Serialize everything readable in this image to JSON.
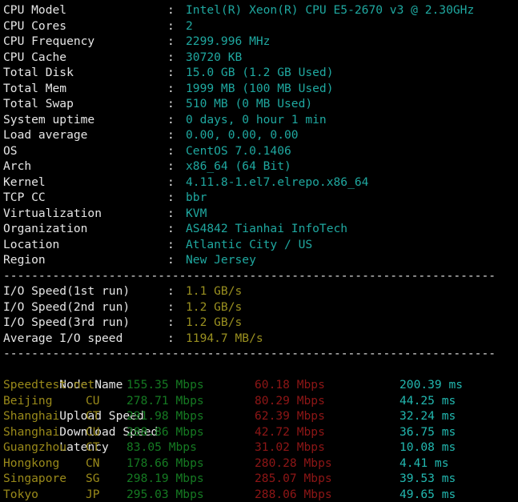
{
  "terminal": {
    "background_color": "#000000",
    "label_color": "#e6e6e6",
    "value_cyan": "#1fa8a0",
    "value_olive": "#9a9020",
    "node_color": "#9a8a1a",
    "upload_color": "#157a22",
    "download_color": "#8e1616",
    "latency_color": "#22b8b0",
    "separator": "----------------------------------------------------------------------"
  },
  "system_info": [
    {
      "label": "CPU Model",
      "value": "Intel(R) Xeon(R) CPU E5-2670 v3 @ 2.30GHz"
    },
    {
      "label": "CPU Cores",
      "value": "2"
    },
    {
      "label": "CPU Frequency",
      "value": "2299.996 MHz"
    },
    {
      "label": "CPU Cache",
      "value": "30720 KB"
    },
    {
      "label": "Total Disk",
      "value": "15.0 GB (1.2 GB Used)"
    },
    {
      "label": "Total Mem",
      "value": "1999 MB (100 MB Used)"
    },
    {
      "label": "Total Swap",
      "value": "510 MB (0 MB Used)"
    },
    {
      "label": "System uptime",
      "value": "0 days, 0 hour 1 min"
    },
    {
      "label": "Load average",
      "value": "0.00, 0.00, 0.00"
    },
    {
      "label": "OS",
      "value": "CentOS 7.0.1406"
    },
    {
      "label": "Arch",
      "value": "x86_64 (64 Bit)"
    },
    {
      "label": "Kernel",
      "value": "4.11.8-1.el7.elrepo.x86_64"
    },
    {
      "label": "TCP CC",
      "value": "bbr"
    },
    {
      "label": "Virtualization",
      "value": "KVM"
    },
    {
      "label": "Organization",
      "value": "AS4842 Tianhai InfoTech"
    },
    {
      "label": "Location",
      "value": "Atlantic City / US"
    },
    {
      "label": "Region",
      "value": "New Jersey"
    }
  ],
  "io_info": [
    {
      "label": "I/O Speed(1st run)",
      "value": "1.1 GB/s"
    },
    {
      "label": "I/O Speed(2nd run)",
      "value": "1.2 GB/s"
    },
    {
      "label": "I/O Speed(3rd run)",
      "value": "1.2 GB/s"
    },
    {
      "label": "Average I/O speed",
      "value": "1194.7 MB/s"
    }
  ],
  "speedtest": {
    "headers": {
      "node": "Node Name",
      "cc": "",
      "upload": "Upload Speed",
      "download": "Download Speed",
      "latency": "Latency"
    },
    "rows": [
      {
        "node": "Speedtest.net",
        "cc": "",
        "upload": "155.35 Mbps",
        "download": "60.18 Mbps",
        "latency": "200.39 ms"
      },
      {
        "node": "Beijing",
        "cc": "CU",
        "upload": "278.71 Mbps",
        "download": "80.29 Mbps",
        "latency": "44.25 ms"
      },
      {
        "node": "Shanghai",
        "cc": "CT",
        "upload": "291.98 Mbps",
        "download": "62.39 Mbps",
        "latency": "32.24 ms"
      },
      {
        "node": "Shanghai",
        "cc": "CU",
        "upload": "288.86 Mbps",
        "download": "42.72 Mbps",
        "latency": "36.75 ms"
      },
      {
        "node": "Guangzhou",
        "cc": "CT",
        "upload": "83.05 Mbps",
        "download": "31.02 Mbps",
        "latency": "10.08 ms"
      },
      {
        "node": "Hongkong",
        "cc": "CN",
        "upload": "178.66 Mbps",
        "download": "280.28 Mbps",
        "latency": "4.41 ms"
      },
      {
        "node": "Singapore",
        "cc": "SG",
        "upload": "298.19 Mbps",
        "download": "285.07 Mbps",
        "latency": "39.53 ms"
      },
      {
        "node": "Tokyo",
        "cc": "JP",
        "upload": "295.03 Mbps",
        "download": "288.06 Mbps",
        "latency": "49.65 ms"
      }
    ]
  }
}
